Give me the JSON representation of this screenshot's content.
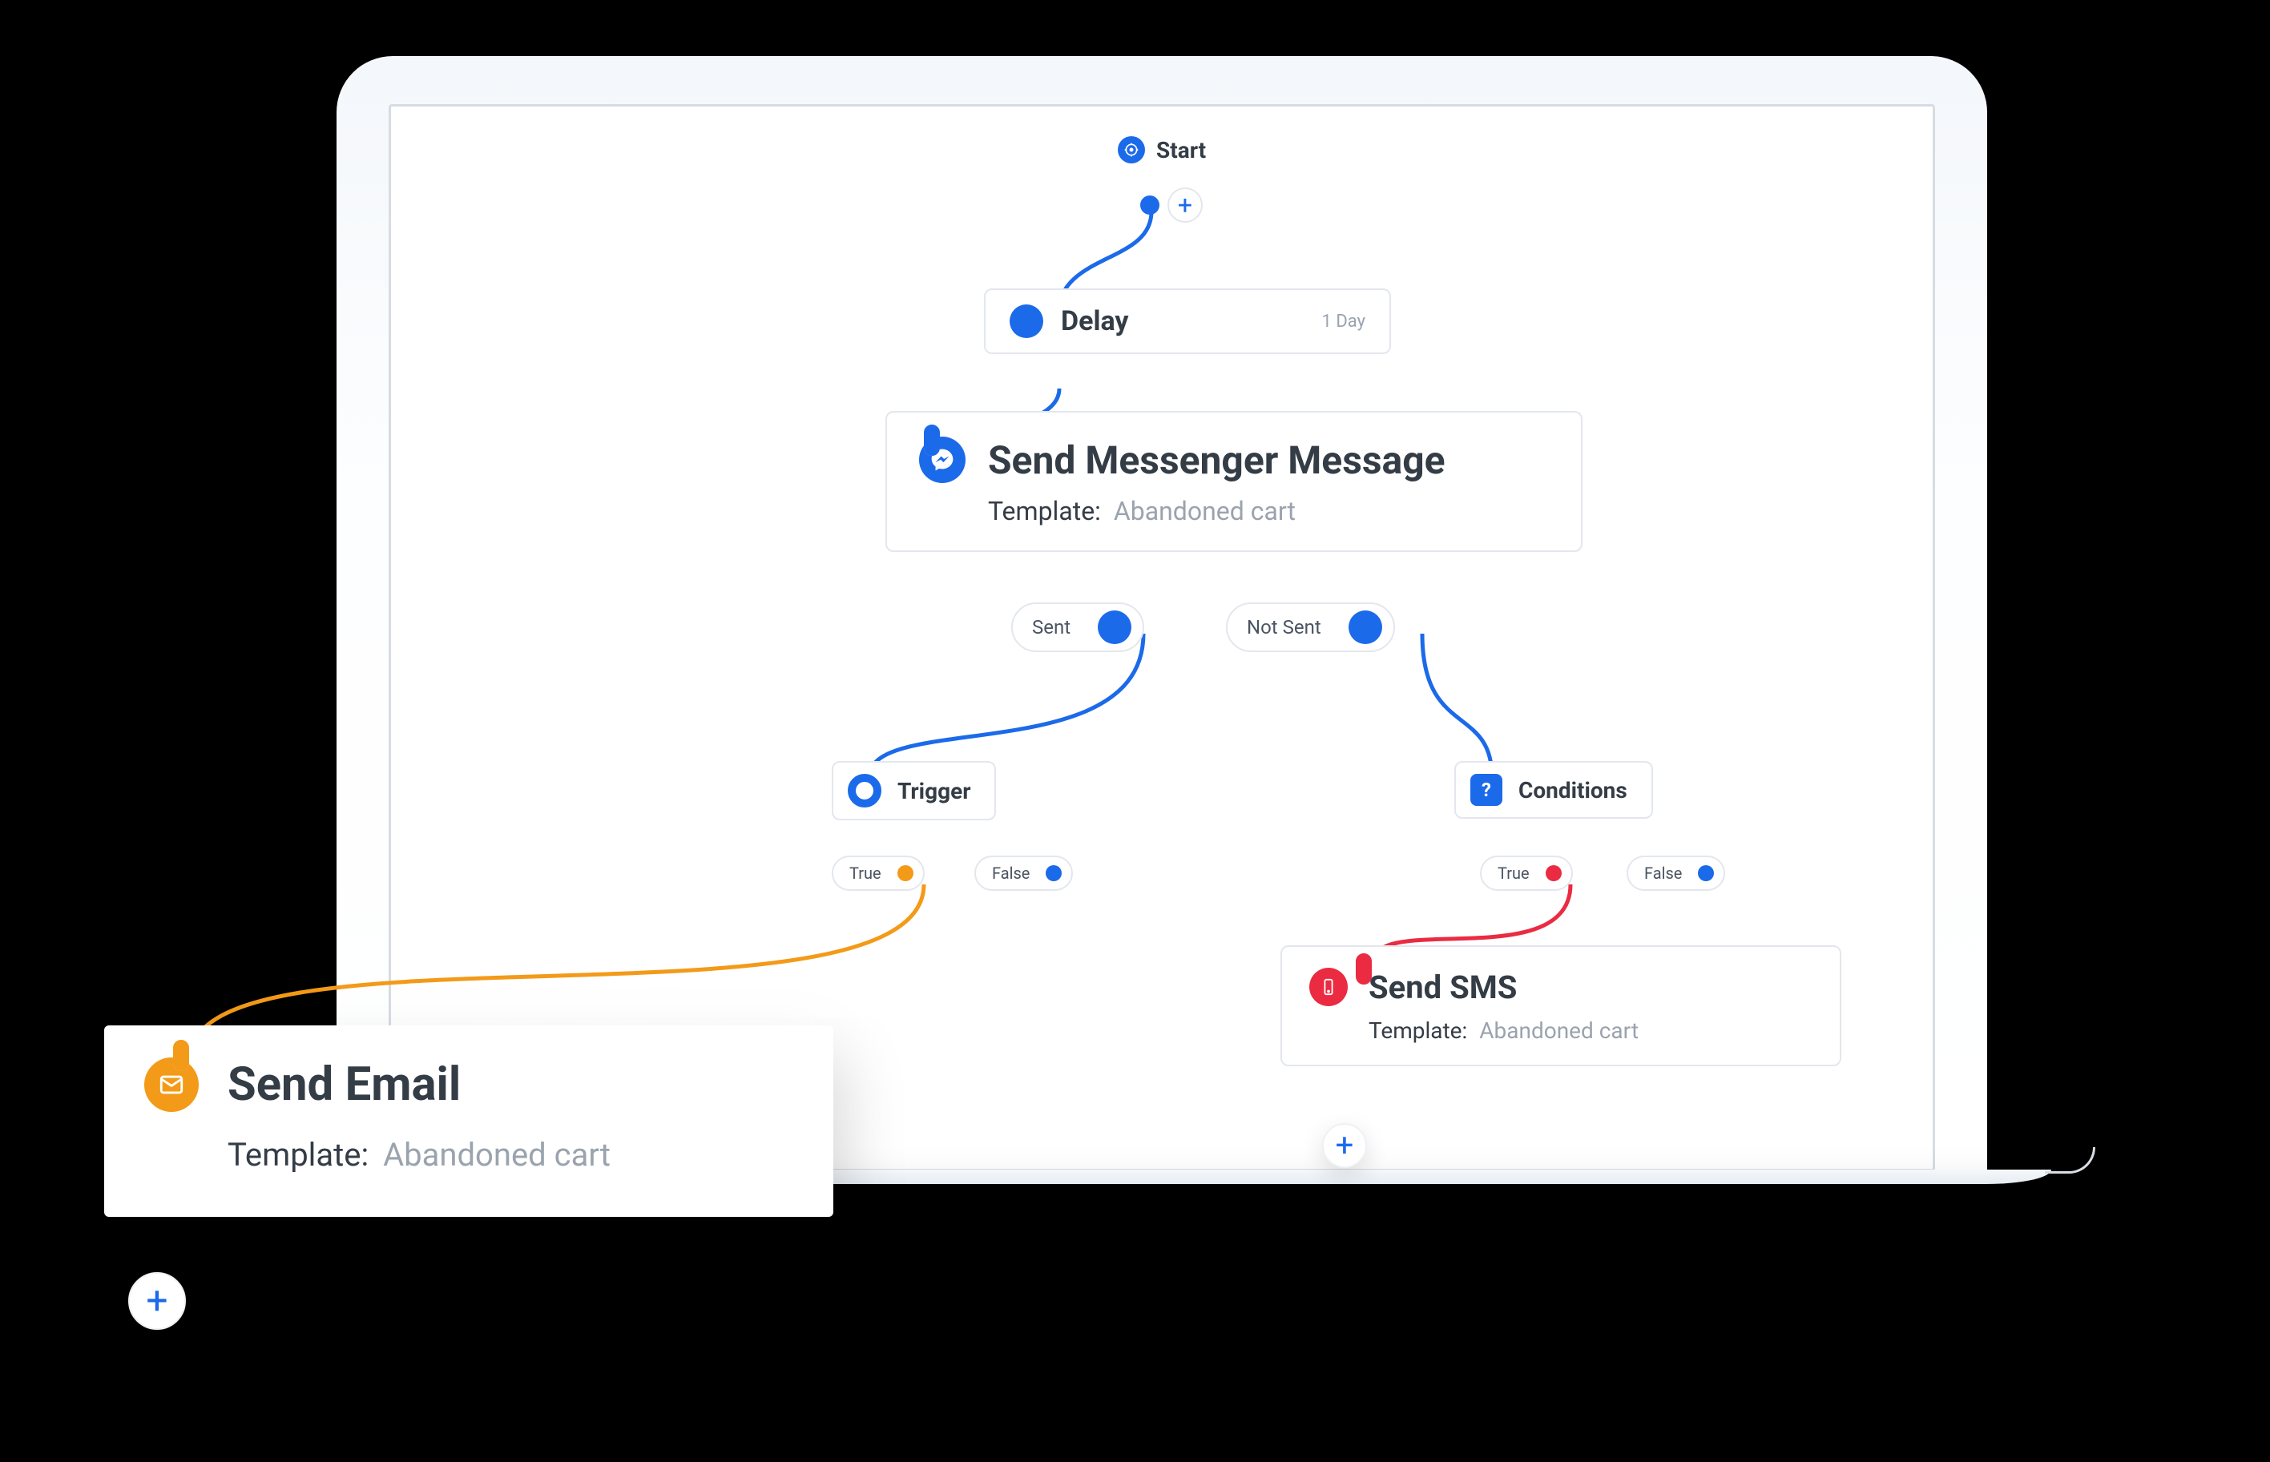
{
  "start": {
    "label": "Start"
  },
  "delay": {
    "label": "Delay",
    "value": "1 Day"
  },
  "messenger": {
    "title": "Send Messenger Message",
    "template_label": "Template:",
    "template_value": "Abandoned cart",
    "branch_sent": "Sent",
    "branch_not_sent": "Not Sent"
  },
  "trigger": {
    "label": "Trigger",
    "branch_true": "True",
    "branch_false": "False"
  },
  "conditions": {
    "label": "Conditions",
    "branch_true": "True",
    "branch_false": "False"
  },
  "sms": {
    "title": "Send SMS",
    "template_label": "Template:",
    "template_value": "Abandoned cart"
  },
  "email": {
    "title": "Send Email",
    "template_label": "Template:",
    "template_value": "Abandoned cart"
  },
  "icons": {
    "start": "target-icon",
    "messenger": "messenger-icon",
    "trigger": "ring-icon",
    "conditions": "question-icon",
    "sms": "phone-icon",
    "email": "mail-icon",
    "plus": "+"
  }
}
